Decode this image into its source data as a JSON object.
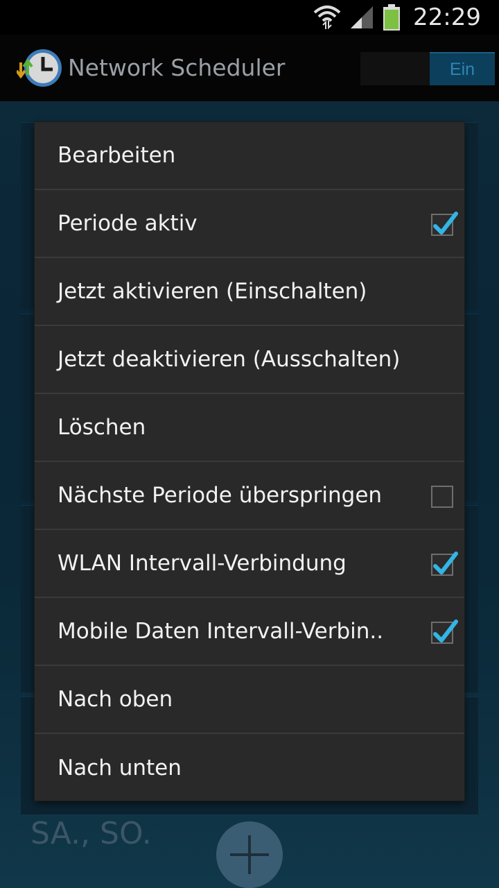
{
  "status_bar": {
    "time": "22:29",
    "icons": [
      "wifi-icon",
      "signal-icon",
      "battery-icon"
    ]
  },
  "action_bar": {
    "title": "Network Scheduler",
    "toggle_label": "Ein"
  },
  "background": {
    "days_label": "SA., SO."
  },
  "menu": {
    "items": [
      {
        "label": "Bearbeiten",
        "checkbox": null
      },
      {
        "label": "Periode aktiv",
        "checkbox": true
      },
      {
        "label": "Jetzt aktivieren (Einschalten)",
        "checkbox": null
      },
      {
        "label": "Jetzt deaktivieren (Ausschalten)",
        "checkbox": null
      },
      {
        "label": "Löschen",
        "checkbox": null
      },
      {
        "label": "Nächste Periode überspringen",
        "checkbox": false
      },
      {
        "label": "WLAN Intervall-Verbindung",
        "checkbox": true
      },
      {
        "label": "Mobile Daten Intervall-Verbin..",
        "checkbox": true
      },
      {
        "label": "Nach oben",
        "checkbox": null
      },
      {
        "label": "Nach unten",
        "checkbox": null
      }
    ]
  },
  "colors": {
    "accent": "#33b5e5",
    "menu_bg": "#292929",
    "divider": "#3a3a3a"
  }
}
